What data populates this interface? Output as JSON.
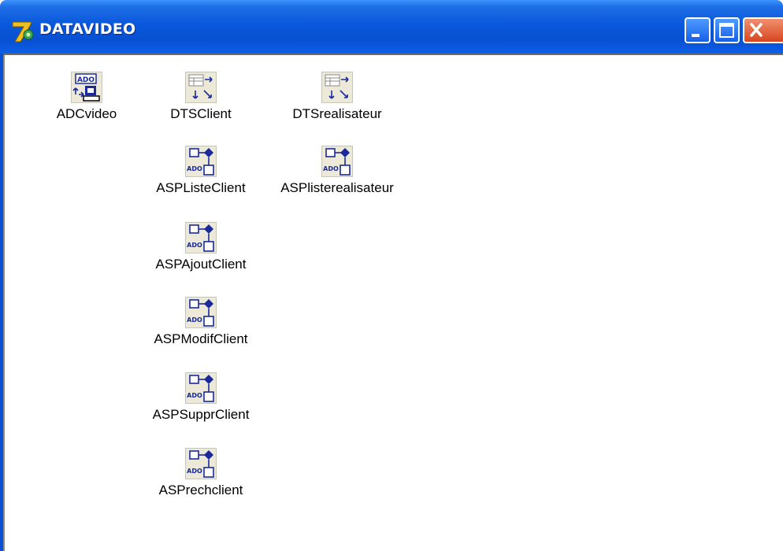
{
  "window": {
    "title": "DATAVIDEO"
  },
  "colors": {
    "titlebar": "#0a58dc",
    "close_button": "#d8461e",
    "icon_blue": "#1a2a9a"
  },
  "components": [
    {
      "name": "ADCvideo",
      "icon": "ado-connection-icon"
    },
    {
      "name": "DTSClient",
      "icon": "dts-icon"
    },
    {
      "name": "DTSrealisateur",
      "icon": "dts-icon"
    },
    {
      "name": "ASPListeClient",
      "icon": "ado-stored-proc-icon"
    },
    {
      "name": "ASPlisterealisateur",
      "icon": "ado-stored-proc-icon"
    },
    {
      "name": "ASPAjoutClient",
      "icon": "ado-stored-proc-icon"
    },
    {
      "name": "ASPModifClient",
      "icon": "ado-stored-proc-icon"
    },
    {
      "name": "ASPSupprClient",
      "icon": "ado-stored-proc-icon"
    },
    {
      "name": "ASPrechclient",
      "icon": "ado-stored-proc-icon"
    }
  ]
}
